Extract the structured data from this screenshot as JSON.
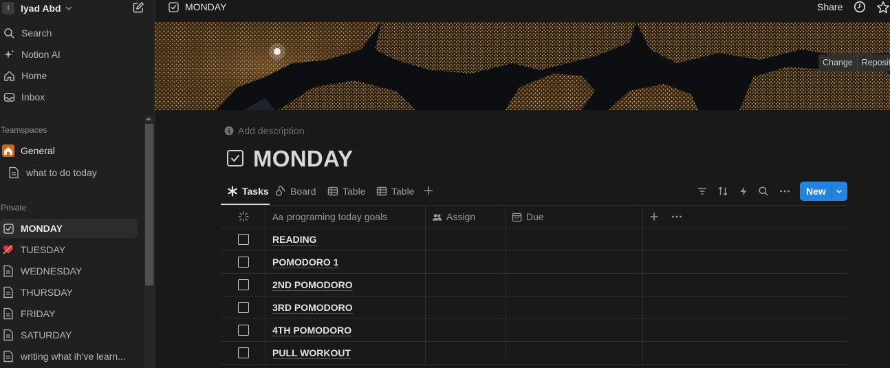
{
  "workspace": {
    "initial": "I",
    "name": "Iyad Abd"
  },
  "nav": [
    {
      "label": "Search",
      "icon": "search-icon"
    },
    {
      "label": "Notion AI",
      "icon": "sparkle-icon"
    },
    {
      "label": "Home",
      "icon": "home-icon"
    },
    {
      "label": "Inbox",
      "icon": "inbox-icon"
    }
  ],
  "sidebar": {
    "teamspaces_label": "Teamspaces",
    "teamspaces": [
      {
        "label": "General",
        "icon": "house-emoji-icon"
      },
      {
        "label": "what to do today",
        "icon": "page-icon"
      }
    ],
    "private_label": "Private",
    "private": [
      {
        "label": "MONDAY",
        "icon": "checkbox-icon"
      },
      {
        "label": "TUESDAY",
        "icon": "heart-emoji-icon"
      },
      {
        "label": "WEDNESDAY",
        "icon": "page-icon"
      },
      {
        "label": "THURSDAY",
        "icon": "page-icon"
      },
      {
        "label": "FRIDAY",
        "icon": "page-icon"
      },
      {
        "label": "SATURDAY",
        "icon": "page-icon"
      },
      {
        "label": "writing what ih've learn...",
        "icon": "page-icon"
      }
    ]
  },
  "topbar": {
    "title": "MONDAY",
    "share": "Share"
  },
  "cover": {
    "change_cover": "Change cover",
    "reposition": "Reposition"
  },
  "page": {
    "add_description": "Add description",
    "title": "MONDAY"
  },
  "views": {
    "tabs": [
      {
        "label": "Tasks",
        "icon": "asterisk-icon"
      },
      {
        "label": "Board",
        "icon": "board-icon"
      },
      {
        "label": "Table",
        "icon": "table-icon"
      },
      {
        "label": "Table",
        "icon": "table-icon"
      }
    ],
    "new_label": "New"
  },
  "table": {
    "columns": [
      {
        "label": "",
        "icon": "loading-icon"
      },
      {
        "label": "programing today goals",
        "prefix": "Aa"
      },
      {
        "label": "Assign",
        "icon": "people-icon"
      },
      {
        "label": "Due",
        "icon": "calendar-icon"
      }
    ],
    "rows": [
      {
        "name": "READING",
        "done": false
      },
      {
        "name": "POMODORO 1",
        "done": false
      },
      {
        "name": "2ND POMODORO",
        "done": false
      },
      {
        "name": "3RD POMODORO",
        "done": false
      },
      {
        "name": "4TH POMODORO",
        "done": false
      },
      {
        "name": "PULL WORKOUT",
        "done": false
      }
    ]
  },
  "colors": {
    "accent": "#2383e2",
    "background": "#191919",
    "sidebar": "#202020"
  }
}
